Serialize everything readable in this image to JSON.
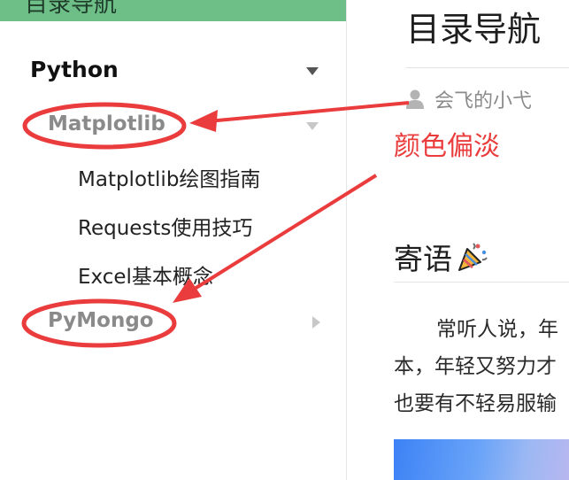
{
  "sidebar": {
    "top_title": "目录导航",
    "items": [
      {
        "label": "Python",
        "level": 1,
        "caret": "chevron-down-icon"
      },
      {
        "label": "Matplotlib",
        "level": 2,
        "caret": "chevron-down-icon"
      },
      {
        "label": "Matplotlib绘图指南",
        "level": 3
      },
      {
        "label": "Requests使用技巧",
        "level": 3
      },
      {
        "label": "Excel基本概念",
        "level": 3
      },
      {
        "label": "PyMongo",
        "level": 2,
        "caret": "chevron-right-icon"
      }
    ]
  },
  "main": {
    "title": "目录导航",
    "author": "会飞的小弋",
    "annotation_note": "颜色偏淡",
    "section_heading": "寄语",
    "paragraph_lines": [
      "常听人说，年",
      "本，年轻又努力才",
      "也要有不轻易服输"
    ]
  },
  "colors": {
    "sidebar_header": "#6dbf87",
    "annotation_red": "#ea3c3c",
    "dim_item_text": "#8a8a8a"
  }
}
